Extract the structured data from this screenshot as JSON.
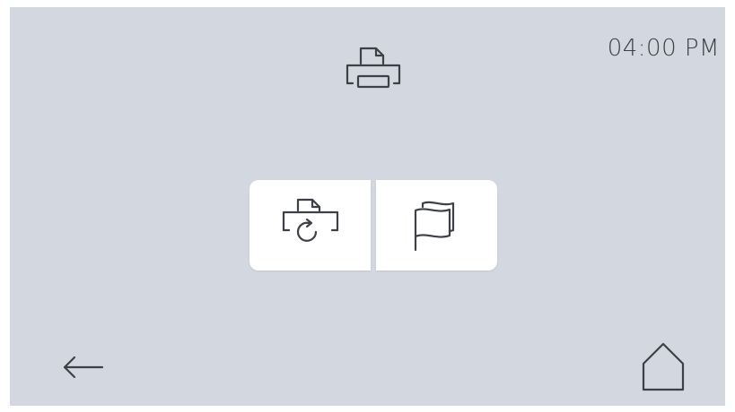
{
  "status_bar": {
    "printer_icon": "printer-icon",
    "time": "04:00 PM"
  },
  "actions": [
    {
      "name": "reprint",
      "icon": "reprint-icon"
    },
    {
      "name": "flag",
      "icon": "flag-icon"
    }
  ],
  "nav": {
    "back_icon": "arrow-left-icon",
    "home_icon": "home-icon"
  },
  "colors": {
    "background": "#d3d7df",
    "tile": "#ffffff",
    "icon": "#3d4046"
  }
}
